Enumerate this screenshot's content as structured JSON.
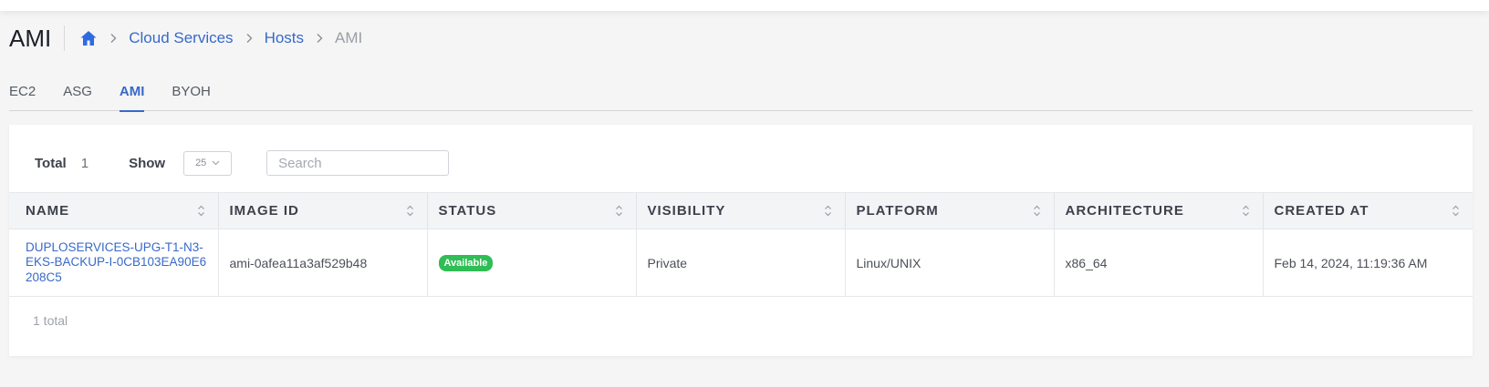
{
  "header": {
    "title": "AMI",
    "breadcrumb": [
      {
        "label": "Cloud Services"
      },
      {
        "label": "Hosts"
      },
      {
        "label": "AMI"
      }
    ]
  },
  "tabs": [
    {
      "label": "EC2",
      "active": false
    },
    {
      "label": "ASG",
      "active": false
    },
    {
      "label": "AMI",
      "active": true
    },
    {
      "label": "BYOH",
      "active": false
    }
  ],
  "toolbar": {
    "total_label": "Total",
    "total_value": "1",
    "show_label": "Show",
    "show_value": "25",
    "search_placeholder": "Search"
  },
  "table": {
    "columns": [
      "NAME",
      "IMAGE ID",
      "STATUS",
      "VISIBILITY",
      "PLATFORM",
      "ARCHITECTURE",
      "CREATED AT"
    ],
    "rows": [
      {
        "name": "DUPLOSERVICES-UPG-T1-N3-EKS-BACKUP-I-0CB103EA90E6208C5",
        "image_id": "ami-0afea11a3af529b48",
        "status": "Available",
        "visibility": "Private",
        "platform": "Linux/UNIX",
        "architecture": "x86_64",
        "created_at": "Feb 14, 2024, 11:19:36 AM"
      }
    ]
  },
  "footer": {
    "total_text": "1 total"
  },
  "colors": {
    "accent": "#3869c9",
    "status_available": "#2fbe55",
    "background": "#f5f5f5"
  }
}
